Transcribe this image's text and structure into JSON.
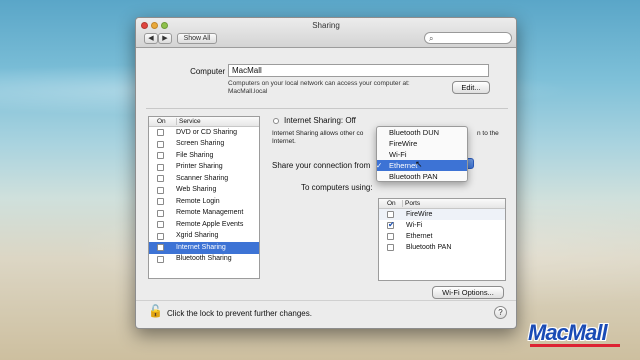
{
  "window": {
    "title": "Sharing",
    "nav": {
      "back": "◀",
      "forward": "▶",
      "show_all": "Show All"
    },
    "search": {
      "placeholder": "",
      "icon": "magnifier"
    }
  },
  "computer": {
    "label": "Computer Name:",
    "value": "MacMall",
    "note_line1": "Computers on your local network can access your computer at:",
    "note_line2": "MacMall.local",
    "edit": "Edit..."
  },
  "services": {
    "header_on": "On",
    "header_service": "Service",
    "items": [
      {
        "label": "DVD or CD Sharing",
        "checked": false,
        "selected": false
      },
      {
        "label": "Screen Sharing",
        "checked": false,
        "selected": false
      },
      {
        "label": "File Sharing",
        "checked": false,
        "selected": false
      },
      {
        "label": "Printer Sharing",
        "checked": false,
        "selected": false
      },
      {
        "label": "Scanner Sharing",
        "checked": false,
        "selected": false
      },
      {
        "label": "Web Sharing",
        "checked": false,
        "selected": false
      },
      {
        "label": "Remote Login",
        "checked": false,
        "selected": false
      },
      {
        "label": "Remote Management",
        "checked": false,
        "selected": false
      },
      {
        "label": "Remote Apple Events",
        "checked": false,
        "selected": false
      },
      {
        "label": "Xgrid Sharing",
        "checked": false,
        "selected": false
      },
      {
        "label": "Internet Sharing",
        "checked": false,
        "selected": true
      },
      {
        "label": "Bluetooth Sharing",
        "checked": false,
        "selected": false
      }
    ]
  },
  "internet_sharing": {
    "status": "Internet Sharing: Off",
    "desc_left": "Internet Sharing allows other co",
    "desc_right_line1": "n to the",
    "desc_line2": "Internet.",
    "share_from_label": "Share your connection from",
    "to_computers_label": "To computers using:"
  },
  "ports": {
    "header_on": "On",
    "header_ports": "Ports",
    "items": [
      {
        "label": "FireWire",
        "checked": false
      },
      {
        "label": "Wi-Fi",
        "checked": true
      },
      {
        "label": "Ethernet",
        "checked": false
      },
      {
        "label": "Bluetooth PAN",
        "checked": false
      }
    ]
  },
  "share_from_menu": {
    "items": [
      {
        "label": "Bluetooth DUN",
        "selected": false
      },
      {
        "label": "FireWire",
        "selected": false
      },
      {
        "label": "Wi-Fi",
        "selected": false
      },
      {
        "label": "Ethernet",
        "selected": true
      },
      {
        "label": "Bluetooth PAN",
        "selected": false
      }
    ],
    "check_mark": "✓"
  },
  "wifi_options": "Wi-Fi Options...",
  "lock_text": "Click the lock to prevent further changes.",
  "help": "?",
  "watermark": "MacMall",
  "colors": {
    "selection": "#3d73d5",
    "logo": "#1a4bb5"
  }
}
